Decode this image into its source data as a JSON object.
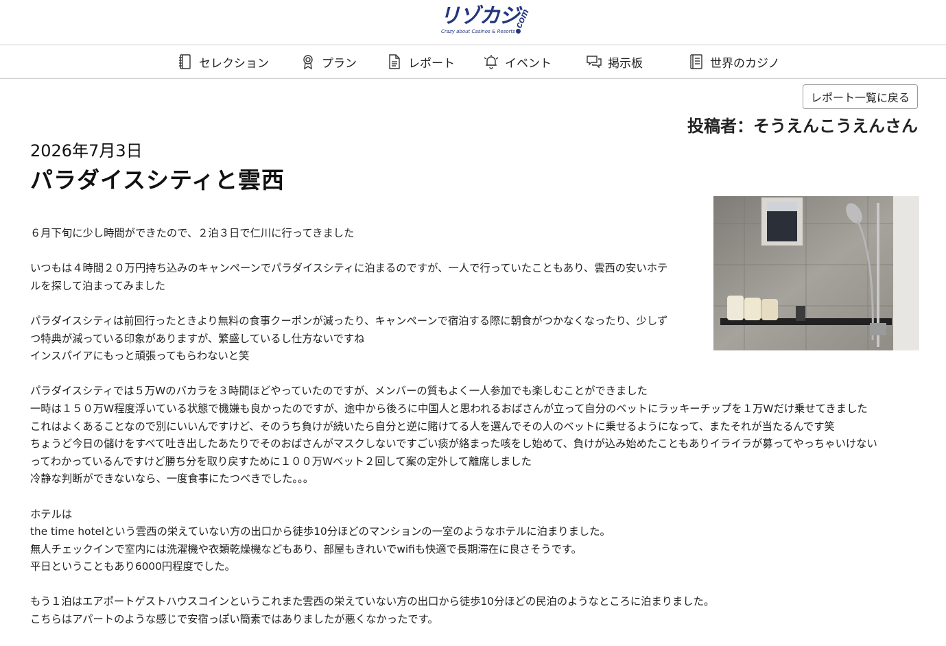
{
  "header": {
    "logo_text": "リゾカジ",
    "logo_domain": ".com",
    "logo_tagline": "Crazy about Casinos & Resorts"
  },
  "nav": {
    "items": [
      {
        "label": "セレクション",
        "icon": "book-icon"
      },
      {
        "label": "プラン",
        "icon": "badge-icon"
      },
      {
        "label": "レポート",
        "icon": "document-icon"
      },
      {
        "label": "イベント",
        "icon": "bell-icon"
      },
      {
        "label": "掲示板",
        "icon": "chat-icon"
      },
      {
        "label": "世界のカジノ",
        "icon": "notebook-icon"
      }
    ]
  },
  "article": {
    "back_button": "レポート一覧に戻る",
    "author": "投稿者：そうえんこうえんさん",
    "date": "2026年7月3日",
    "title": "パラダイスシティと雲西",
    "paragraphs": [
      [
        "６月下旬に少し時間ができたので、２泊３日で仁川に行ってきました"
      ],
      [
        "いつもは４時間２０万円持ち込みのキャンペーンでパラダイスシティに泊まるのですが、一人で行っていたこともあり、雲西の安いホテ",
        "ルを探して泊まってみました"
      ],
      [
        "パラダイスシティは前回行ったときより無料の食事クーポンが減ったり、キャンペーンで宿泊する際に朝食がつかなくなったり、少しず",
        "つ特典が減っている印象がありますが、繁盛しているし仕方ないですね",
        "インスパイアにもっと頑張ってもらわないと笑"
      ],
      [
        "パラダイスシティでは５万Wのバカラを３時間ほどやっていたのですが、メンバーの質もよく一人参加でも楽しむことができました",
        "一時は１５０万W程度浮いている状態で機嫌も良かったのですが、途中から後ろに中国人と思われるおばさんが立って自分のベットにラッキーチップを１万Wだけ乗せてきました",
        "これはよくあることなので別にいいんですけど、そのうち負けが続いたら自分と逆に賭けてる人を選んでその人のベットに乗せるようになって、またそれが当たるんです笑",
        "ちょうど今日の儲けをすべて吐き出したあたりでそのおばさんがマスクしないですごい痰が絡まった咳をし始めて、負けが込み始めたこともありイライラが募ってやっちゃいけない",
        "ってわかっているんですけど勝ち分を取り戻すために１００万Wベット２回して案の定外して離席しました",
        "冷静な判断ができないなら、一度食事にたつべきでした。。。"
      ],
      [
        "ホテルは",
        "the time hotelという雲西の栄えていない方の出口から徒歩10分ほどのマンションの一室のようなホテルに泊まりました。",
        "無人チェックインで室内には洗濯機や衣類乾燥機などもあり、部屋もきれいでwifiも快適で長期滞在に良さそうです。",
        "平日ということもあり6000円程度でした。"
      ],
      [
        "もう１泊はエアポートゲストハウスコインというこれまた雲西の栄えていない方の出口から徒歩10分ほどの民泊のようなところに泊まりました。",
        "こちらはアパートのような感じで安宿っぽい簡素ではありましたが悪くなかったです。"
      ]
    ]
  }
}
